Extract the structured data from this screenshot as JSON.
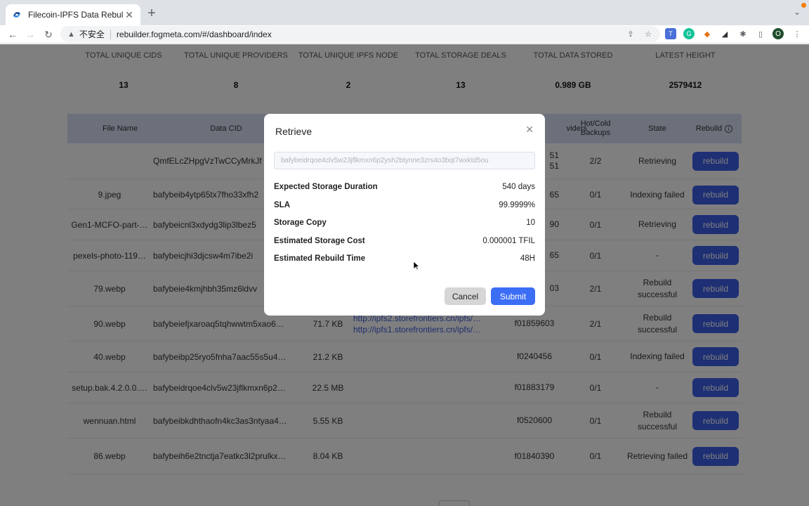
{
  "browser": {
    "tab_title": "Filecoin-IPFS Data Rebulider",
    "insecure_label": "不安全",
    "url": "rebuilder.fogmeta.com/#/dashboard/index",
    "profile_initial": "O"
  },
  "stats": [
    {
      "label": "TOTAL UNIQUE CIDS",
      "value": "13"
    },
    {
      "label": "TOTAL UNIQUE PROVIDERS",
      "value": "8"
    },
    {
      "label": "TOTAL UNIQUE IPFS NODE",
      "value": "2"
    },
    {
      "label": "TOTAL STORAGE DEALS",
      "value": "13"
    },
    {
      "label": "TOTAL DATA STORED",
      "value": "0.989 GB"
    },
    {
      "label": "LATEST HEIGHT",
      "value": "2579412"
    }
  ],
  "table": {
    "headers": {
      "file_name": "File Name",
      "data_cid": "Data CID",
      "providers": "viders",
      "backups_line1": "Hot/Cold",
      "backups_line2": "Backups",
      "state": "State",
      "rebuild": "Rebuild"
    },
    "rows": [
      {
        "file": "",
        "cid": "QmfELcZHpgVzTwCCyMrkJf",
        "size": "",
        "link1": "",
        "link2": "",
        "provider": "51",
        "provider2": "51",
        "backups": "2/2",
        "state": "Retrieving",
        "action": "rebuild"
      },
      {
        "file": "9.jpeg",
        "cid": "bafybeib4ytp65tx7fho33xfh2",
        "size": "",
        "link1": "",
        "link2": "",
        "provider": "65",
        "provider2": "",
        "backups": "0/1",
        "state": "Indexing failed",
        "action": "rebuild"
      },
      {
        "file": "Gen1-MCFO-part-…",
        "cid": "bafybeicnl3xdydg3lip3lbez5",
        "size": "",
        "link1": "",
        "link2": "",
        "provider": "90",
        "provider2": "",
        "backups": "0/1",
        "state": "Retrieving",
        "action": "rebuild"
      },
      {
        "file": "pexels-photo-119…",
        "cid": "bafybeicjhi3djcsw4m7ibe2i",
        "size": "",
        "link1": "",
        "link2": "",
        "provider": "65",
        "provider2": "",
        "backups": "0/1",
        "state": "-",
        "action": "rebuild"
      },
      {
        "file": "79.webp",
        "cid": "bafybeie4kmjhbh35mz6ldvv",
        "size": "",
        "link1": "",
        "link2": "",
        "provider": "03",
        "provider2": "",
        "backups": "2/1",
        "state": "Rebuild successful",
        "action": "rebuild"
      },
      {
        "file": "90.webp",
        "cid": "bafybeiefjxaroaq5tqhwwtm5xao6…",
        "size": "71.7 KB",
        "link1": "http://ipfs2.storefrontiers.cn/ipfs/…",
        "link2": "http://ipfs1.storefrontiers.cn/ipfs/…",
        "provider": "f01859603",
        "provider2": "",
        "backups": "2/1",
        "state": "Rebuild successful",
        "action": "rebuild"
      },
      {
        "file": "40.webp",
        "cid": "bafybeibp25ryo5fnha7aac55s5u4…",
        "size": "21.2 KB",
        "link1": "",
        "link2": "",
        "provider": "f0240456",
        "provider2": "",
        "backups": "0/1",
        "state": "Indexing failed",
        "action": "rebuild"
      },
      {
        "file": "setup.bak.4.2.0.0.…",
        "cid": "bafybeidrqoe4clv5w23jflkmxn6p2…",
        "size": "22.5 MB",
        "link1": "",
        "link2": "",
        "provider": "f01883179",
        "provider2": "",
        "backups": "0/1",
        "state": "-",
        "action": "rebuild"
      },
      {
        "file": "wennuan.html",
        "cid": "bafybeibkdhthaofn4kc3as3ntyaa4…",
        "size": "5.55 KB",
        "link1": "",
        "link2": "",
        "provider": "f0520600",
        "provider2": "",
        "backups": "0/1",
        "state": "Rebuild successful",
        "action": "rebuild"
      },
      {
        "file": "86.webp",
        "cid": "bafybeih6e2tnctja7eatkc3l2prulkx…",
        "size": "8.04 KB",
        "link1": "",
        "link2": "",
        "provider": "f01840390",
        "provider2": "",
        "backups": "0/1",
        "state": "Retrieving failed",
        "action": "rebuild"
      }
    ]
  },
  "modal": {
    "title": "Retrieve",
    "cid_value": "bafybeidrqoe4clv5w23jflkmxn6p2ysh2btynne3zrs4o3bqt7wxktd5ou",
    "fields": [
      {
        "label": "Expected Storage Duration",
        "value": "540 days"
      },
      {
        "label": "SLA",
        "value": "99.9999%"
      },
      {
        "label": "Storage Copy",
        "value": "10"
      },
      {
        "label": "Estimated Storage Cost",
        "value": "0.000001 TFIL"
      },
      {
        "label": "Estimated Rebuild Time",
        "value": "48H"
      }
    ],
    "cancel_label": "Cancel",
    "submit_label": "Submit"
  }
}
